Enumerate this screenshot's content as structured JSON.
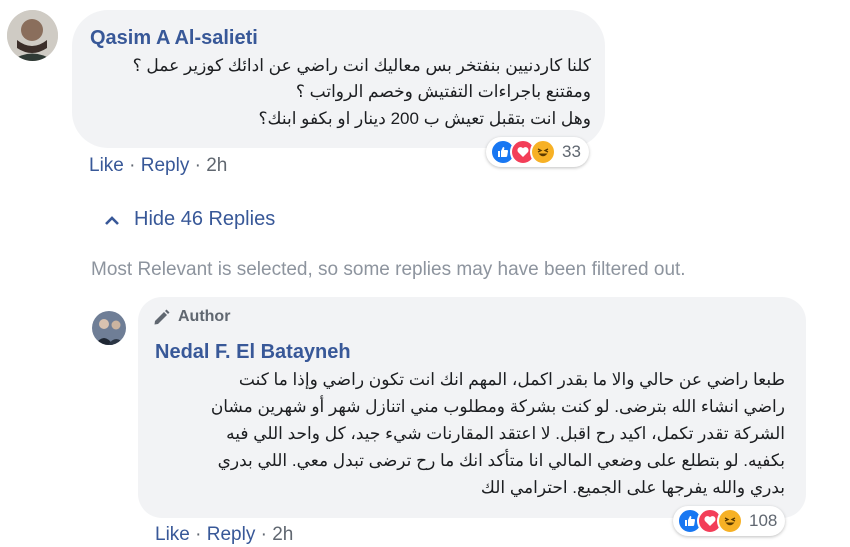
{
  "comment": {
    "author": "Qasim A Al-salieti",
    "lines": [
      "كلنا كاردنيين بنفتخر بس معاليك انت راضي عن ادائك كوزير عمل ؟",
      "ومقتنع باجراءات التفتيش وخصم الرواتب ؟",
      "وهل انت بتقبل تعيش ب 200 دينار او بكفو ابنك؟"
    ],
    "reaction_count": "33",
    "like_label": "Like",
    "reply_label": "Reply",
    "time": "2h"
  },
  "replies_toggle": {
    "label": "Hide 46 Replies"
  },
  "filter_note": "Most Relevant is selected, so some replies may have been filtered out.",
  "reply": {
    "badge": "Author",
    "author": "Nedal F. El Batayneh",
    "lines": [
      "طبعا راضي عن حالي والا ما بقدر اكمل، المهم انك انت تكون راضي وإذا ما كنت",
      "راضي انشاء الله بترضى. لو كنت بشركة ومطلوب مني اتنازل شهر أو شهرين مشان",
      "الشركة تقدر تكمل، اكيد رح اقبل. لا اعتقد المقارنات شيء جيد، كل واحد اللي فيه",
      "بكفيه. لو بتطلع على وضعي المالي انا متأكد انك ما رح ترضى تبدل معي. اللي بدري",
      "بدري والله يفرجها على الجميع. احترامي الك"
    ],
    "reaction_count": "108",
    "like_label": "Like",
    "reply_label": "Reply",
    "time": "2h"
  },
  "colors": {
    "link_blue": "#385898",
    "bubble_gray": "#f2f3f5",
    "meta_gray": "#606770",
    "like_blue": "#1877f2",
    "love_red": "#f33e58",
    "haha_yellow": "#f7b125"
  },
  "icons": {
    "chevron": "chevron-up-icon",
    "author_badge": "pencil-icon",
    "reactions": [
      "like-icon",
      "love-icon",
      "haha-icon"
    ]
  }
}
